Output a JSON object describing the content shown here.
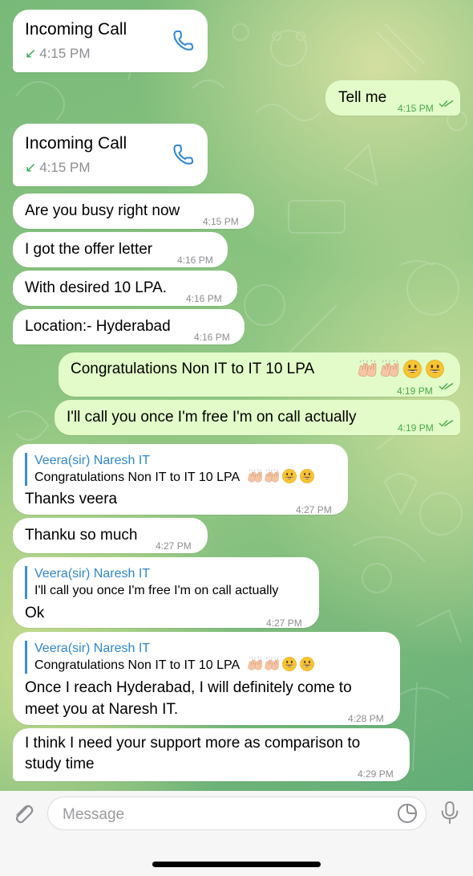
{
  "colors": {
    "incoming_bubble": "#ffffff",
    "outgoing_bubble": "#e2fbc9",
    "accent_blue": "#2f86d0",
    "read_check_green": "#4aa94a",
    "call_arrow_green": "#34a853"
  },
  "messages": [
    {
      "type": "call",
      "direction": "in",
      "title": "Incoming Call",
      "time": "4:15 PM",
      "icon": "phone-icon"
    },
    {
      "type": "text",
      "direction": "out",
      "text": "Tell me",
      "time": "4:15 PM",
      "status": "read"
    },
    {
      "type": "call",
      "direction": "in",
      "title": "Incoming Call",
      "time": "4:15 PM",
      "icon": "phone-icon"
    },
    {
      "type": "text",
      "direction": "in",
      "text": "Are you busy right now",
      "time": "4:15 PM"
    },
    {
      "type": "text",
      "direction": "in",
      "text": "I got the offer letter",
      "time": "4:16 PM"
    },
    {
      "type": "text",
      "direction": "in",
      "text": "With desired 10 LPA.",
      "time": "4:16 PM"
    },
    {
      "type": "text",
      "direction": "in",
      "text": "Location:- Hyderabad",
      "time": "4:16 PM"
    },
    {
      "type": "text",
      "direction": "out",
      "text": "Congratulations  Non IT  to IT 10 LPA",
      "emoji": "raising-hands-x2 smiley-x2",
      "time": "4:19 PM",
      "status": "read"
    },
    {
      "type": "text",
      "direction": "out",
      "text": "I'll call you once I'm free I'm on call actually",
      "time": "4:19 PM",
      "status": "read"
    },
    {
      "type": "reply",
      "direction": "in",
      "reply_name": "Veera(sir) Naresh IT",
      "reply_text": "Congratulations Non IT to IT 10 LPA",
      "text": "Thanks veera",
      "time": "4:27 PM"
    },
    {
      "type": "text",
      "direction": "in",
      "text": "Thanku so much",
      "time": "4:27 PM"
    },
    {
      "type": "reply",
      "direction": "in",
      "reply_name": "Veera(sir) Naresh IT",
      "reply_text": "I'll call you once I'm free I'm on call actually",
      "text": "Ok",
      "time": "4:27 PM"
    },
    {
      "type": "reply",
      "direction": "in",
      "reply_name": "Veera(sir) Naresh IT",
      "reply_text": "Congratulations Non IT to IT 10 LPA",
      "lines": [
        "Once I reach Hyderabad, I will definitely come to",
        "meet you at Naresh IT."
      ],
      "time": "4:28 PM"
    },
    {
      "type": "text",
      "direction": "in",
      "lines": [
        "I think I need your support more as comparison to",
        "study time"
      ],
      "time": "4:29 PM"
    }
  ],
  "composer": {
    "placeholder": "Message",
    "attach_icon": "paperclip-icon",
    "sticker_icon": "sticker-icon",
    "mic_icon": "microphone-icon"
  }
}
